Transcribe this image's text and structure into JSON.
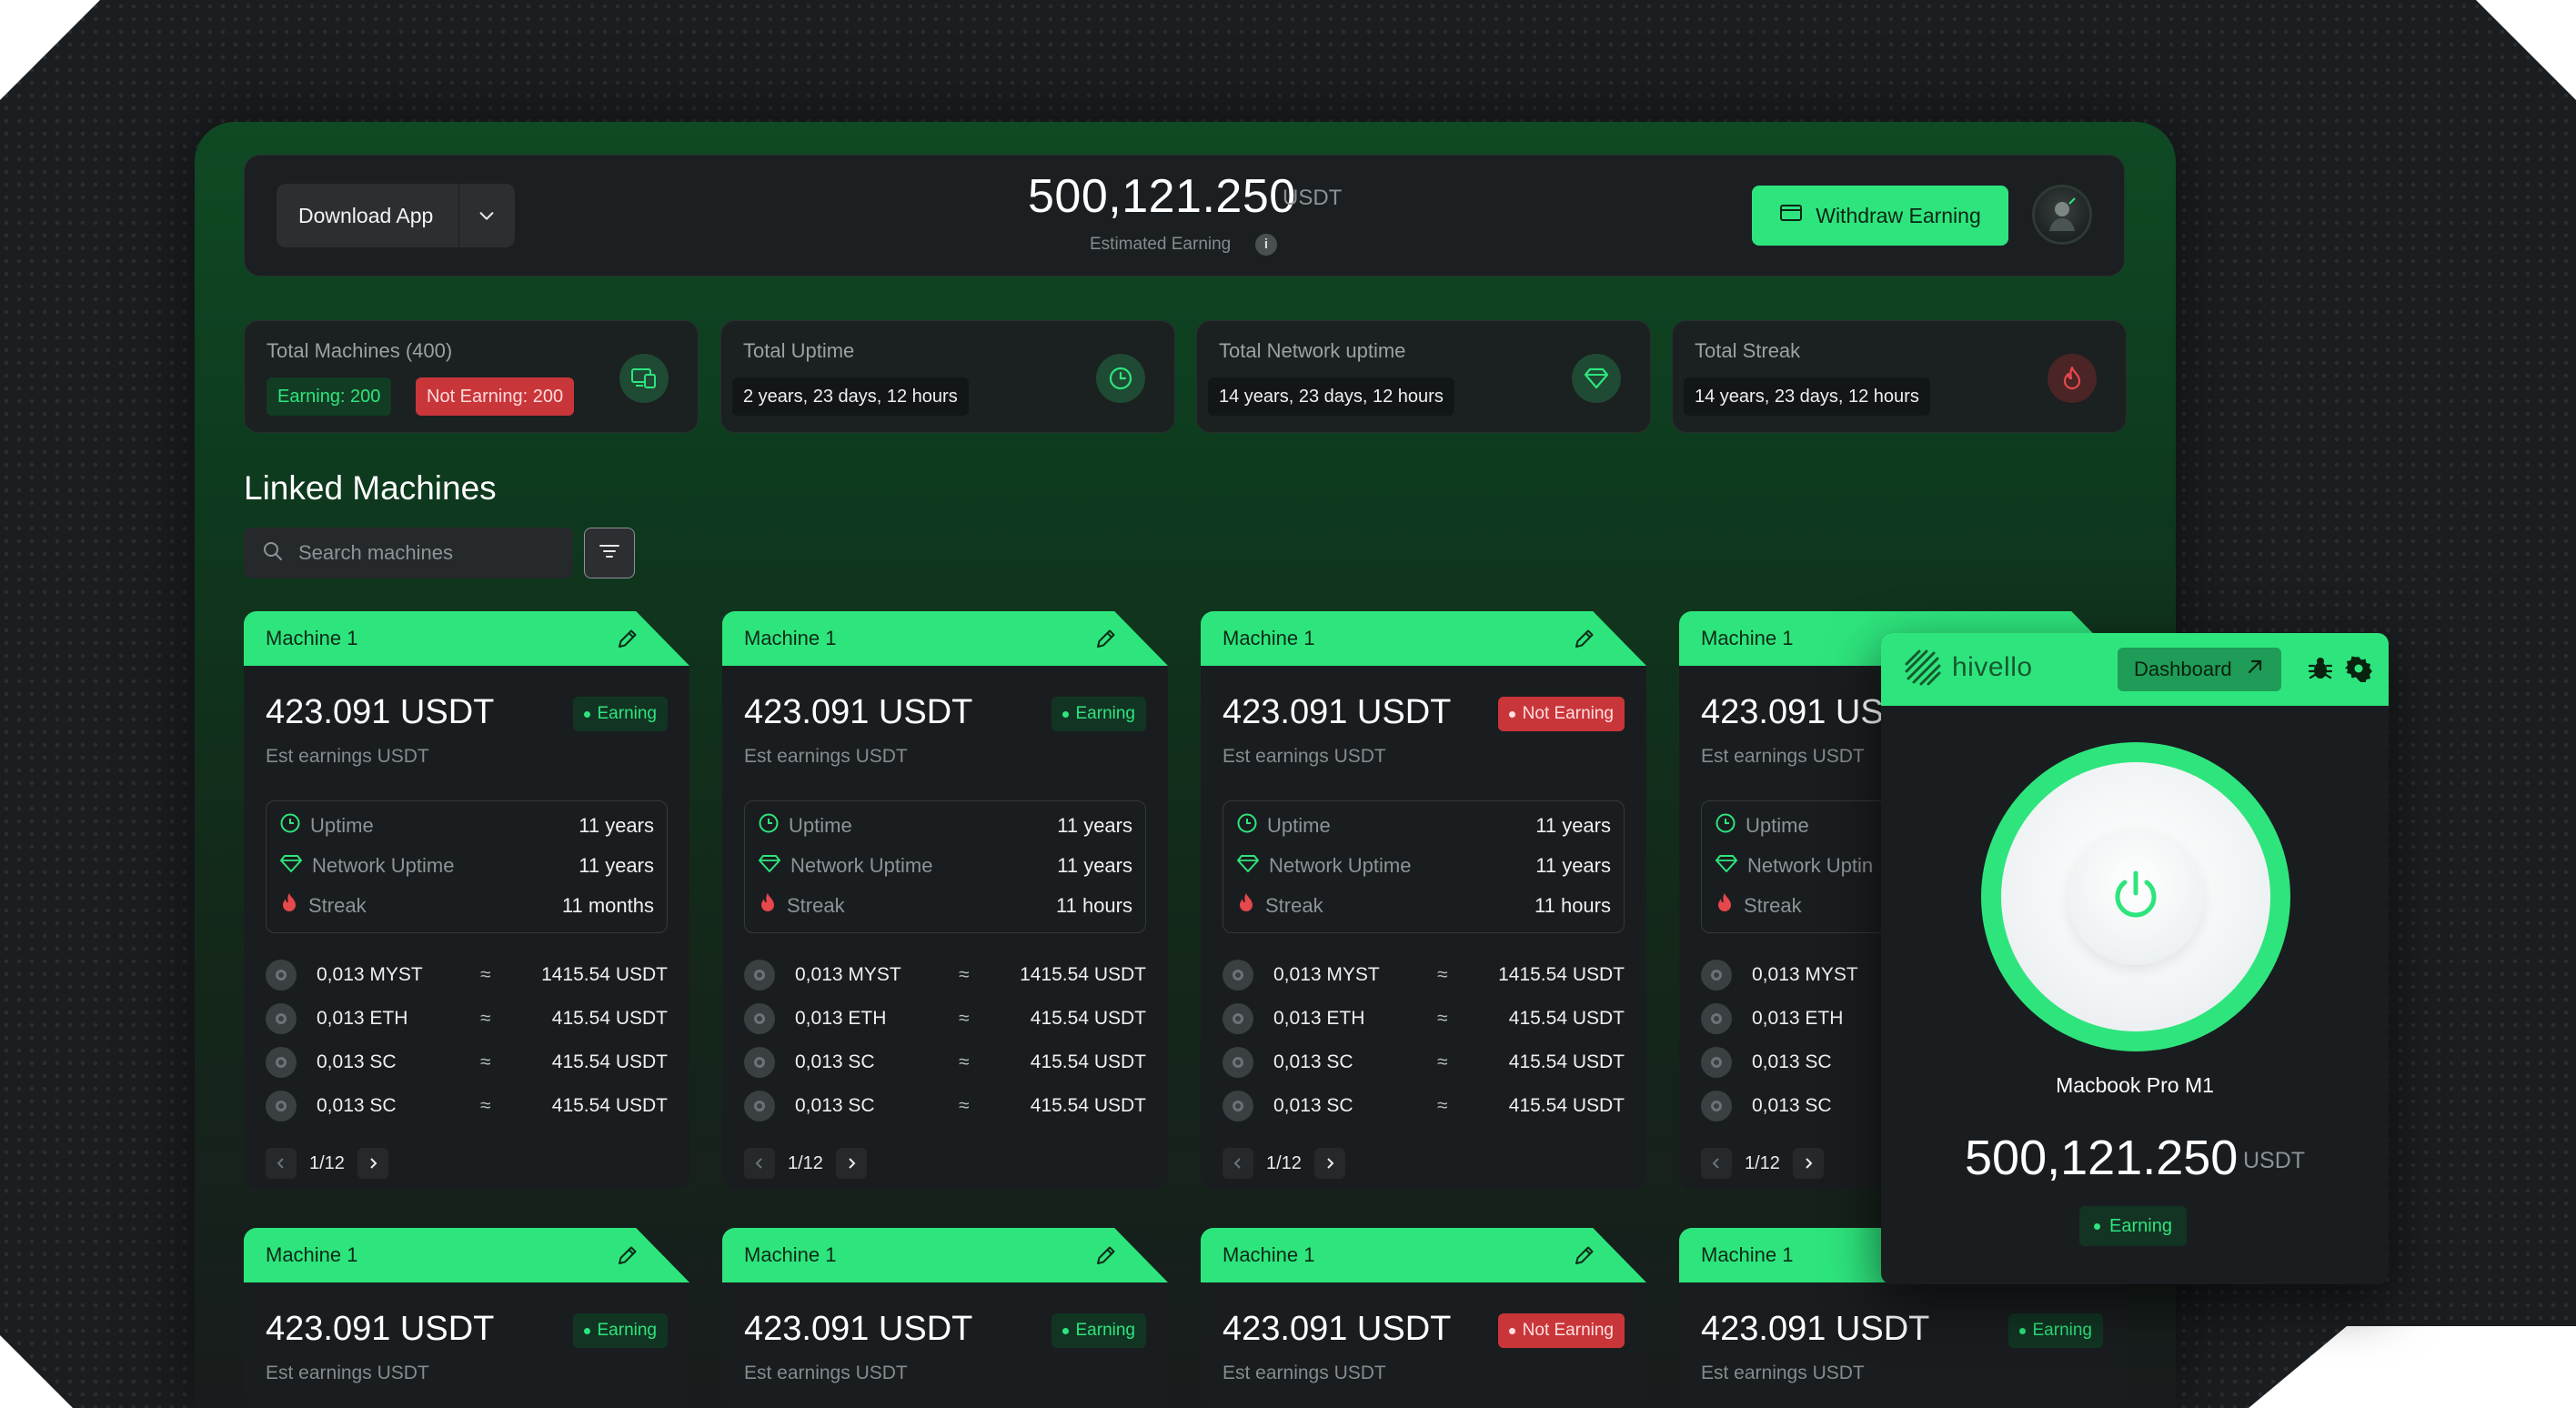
{
  "header": {
    "download_label": "Download App",
    "amount": "500,121.250",
    "unit": "USDT",
    "estimated_label": "Estimated Earning",
    "info_glyph": "i",
    "withdraw_label": "Withdraw Earning"
  },
  "stats": {
    "machines": {
      "title": "Total Machines (400)",
      "earning": "Earning:  200",
      "not_earning": "Not Earning:  200",
      "icon": "devices-icon"
    },
    "uptime": {
      "title": "Total Uptime",
      "value": "2 years, 23 days, 12 hours",
      "icon": "clock-icon"
    },
    "network": {
      "title": "Total Network uptime",
      "value": "14 years, 23 days, 12 hours",
      "icon": "diamond-icon"
    },
    "streak": {
      "title": "Total Streak",
      "value": "14 years, 23 days, 12 hours",
      "icon": "flame-icon"
    }
  },
  "linked": {
    "title": "Linked Machines",
    "search_placeholder": "Search machines"
  },
  "card": {
    "name": "Machine 1",
    "amount": "423.091 USDT",
    "sub": "Est earnings USDT",
    "status_earning": "Earning",
    "status_not": "Not Earning",
    "uptime_label": "Uptime",
    "network_label": "Network Uptime",
    "streak_label": "Streak",
    "uptime_value": "11 years",
    "network_value": "11 years",
    "streak_months": "11 months",
    "streak_hours": "11 hours",
    "coins": [
      {
        "name": "0,013 MYST",
        "approx": "≈",
        "value": "1415.54 USDT"
      },
      {
        "name": "0,013 ETH",
        "approx": "≈",
        "value": "415.54 USDT"
      },
      {
        "name": "0,013 SC",
        "approx": "≈",
        "value": "415.54 USDT"
      },
      {
        "name": "0,013 SC",
        "approx": "≈",
        "value": "415.54 USDT"
      }
    ],
    "page": "1/12",
    "partial_amount": "423.091 USI",
    "partial_network": "Network Uptin"
  },
  "popup": {
    "brand": "hivello",
    "dashboard_label": "Dashboard",
    "machine_name": "Macbook Pro M1",
    "amount": "500,121.250",
    "unit": "USDT",
    "status": "Earning"
  },
  "colors": {
    "accent": "#2ee57d",
    "danger": "#c9363a",
    "surface": "#1a1d1f"
  }
}
